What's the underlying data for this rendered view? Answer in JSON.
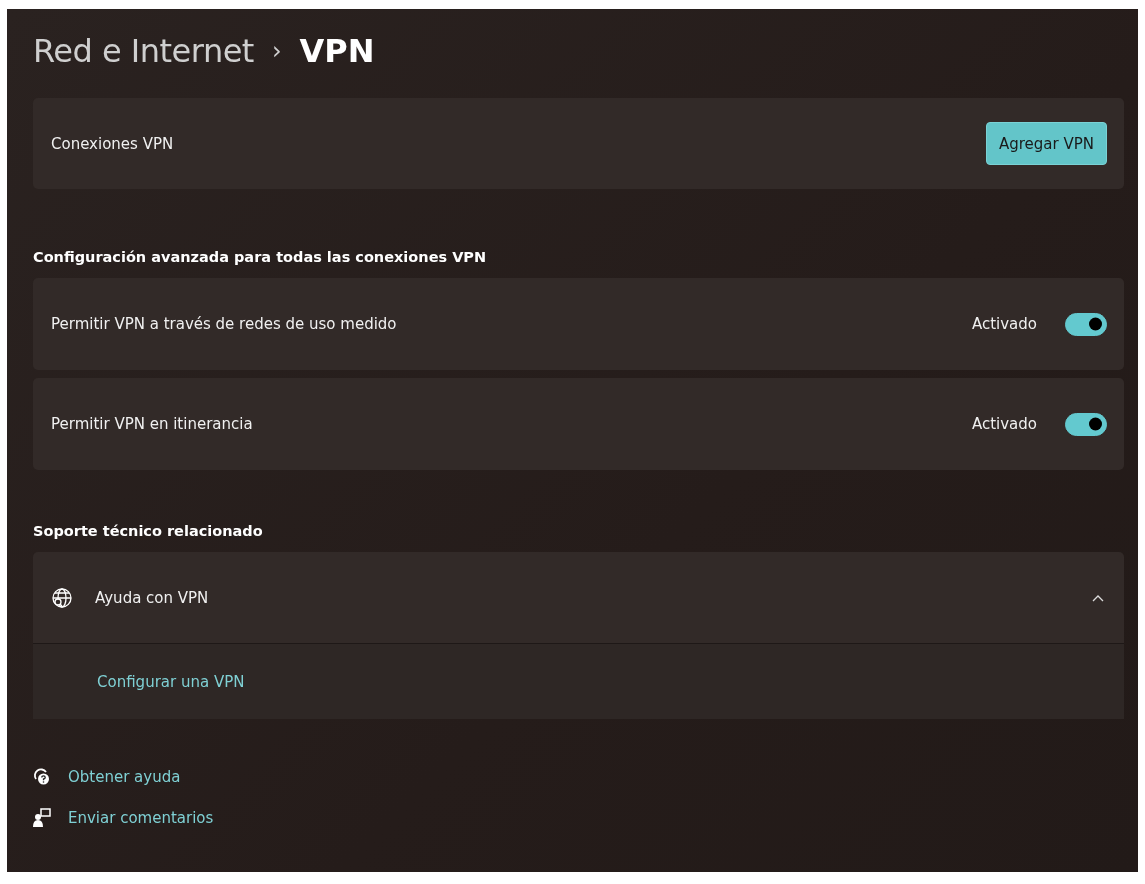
{
  "breadcrumb": {
    "parent": "Red e Internet",
    "separator": "›",
    "current": "VPN"
  },
  "connections": {
    "label": "Conexiones VPN",
    "button": "Agregar VPN"
  },
  "advanced": {
    "heading": "Configuración avanzada para todas las conexiones VPN",
    "settings": [
      {
        "label": "Permitir VPN a través de redes de uso medido",
        "state_text": "Activado",
        "on": true
      },
      {
        "label": "Permitir VPN en itinerancia",
        "state_text": "Activado",
        "on": true
      }
    ]
  },
  "support": {
    "heading": "Soporte técnico relacionado",
    "expander": {
      "title": "Ayuda con VPN",
      "expanded": true,
      "links": [
        "Configurar una VPN"
      ]
    }
  },
  "footer_links": [
    {
      "kind": "help",
      "label": "Obtener ayuda"
    },
    {
      "kind": "feedback",
      "label": "Enviar comentarios"
    }
  ]
}
